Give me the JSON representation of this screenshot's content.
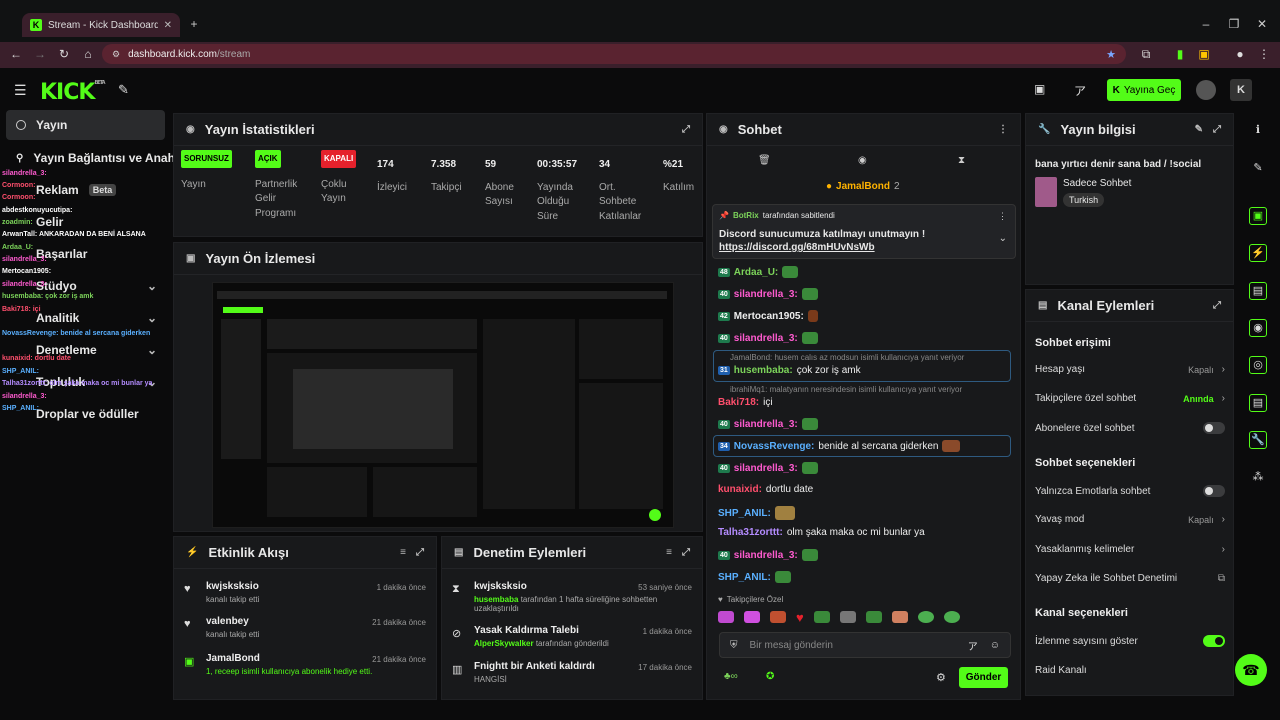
{
  "browser": {
    "tab_title": "Stream - Kick Dashboard",
    "url_domain": "dashboard.kick.com",
    "url_path": "/stream"
  },
  "app": {
    "logo": "KICK",
    "logo_beta": "BETA",
    "go_live": "Yayına Geç"
  },
  "sidebar": {
    "items": [
      {
        "label": "Yayın"
      },
      {
        "label": "Yayın Bağlantısı ve Anahtarı"
      },
      {
        "label": "Reklam",
        "badge": "Beta"
      },
      {
        "label": "Gelir"
      },
      {
        "label": "Başarılar"
      },
      {
        "label": "Stüdyo"
      },
      {
        "label": "Analitik"
      },
      {
        "label": "Denetleme"
      },
      {
        "label": "Topluluk"
      },
      {
        "label": "Droplar ve ödüller"
      }
    ],
    "overlay": [
      "silandrella_3:",
      "Cormoon:",
      "Cormoon:",
      "abdestkonuyucutipa:",
      "zoadmin:",
      "ArwanTall: ANKARADAN DA BENİ ALSANA",
      "Ardaa_U:",
      "silandrella_3:",
      "Mertocan1905:",
      "silandrella_3:",
      "husembaba: çok zor iş amk",
      "Baki718: içi",
      "NovassRevenge: benide al sercana giderken",
      "kunaixid: dortlu date",
      "SHP_ANIL:",
      "Talha31zorttt: olm şaka maka oc mi bunlar ya",
      "silandrella_3:",
      "SHP_ANIL:"
    ]
  },
  "stats": {
    "title": "Yayın İstatistikleri",
    "items": [
      {
        "badge": "SORUNSUZ",
        "label": "Yayın",
        "color": "#53fc18"
      },
      {
        "badge": "AÇIK",
        "label": "Partnerlik Gelir Programı",
        "color": "#53fc18"
      },
      {
        "badge": "KAPALI",
        "label": "Çoklu Yayın",
        "color": "#e5212c"
      },
      {
        "value": "174",
        "label": "İzleyici"
      },
      {
        "value": "7.358",
        "label": "Takipçi"
      },
      {
        "value": "59",
        "label": "Abone Sayısı"
      },
      {
        "value": "00:35:57",
        "label": "Yayında Olduğu Süre"
      },
      {
        "value": "34",
        "label": "Ort. Sohbete Katılanlar"
      },
      {
        "value": "%21",
        "label": "Katılım"
      }
    ]
  },
  "preview": {
    "title": "Yayın Ön İzlemesi"
  },
  "activity": {
    "title": "Etkinlik Akışı",
    "items": [
      {
        "name": "kwjsksksio",
        "sub": "kanalı takip etti",
        "time": "1 dakika önce"
      },
      {
        "name": "valenbey",
        "sub": "kanalı takip etti",
        "time": "21 dakika önce"
      },
      {
        "name": "JamalBond",
        "sub": "1, receep isimli kullanıcıya abonelik hediye etti.",
        "time": "21 dakika önce"
      }
    ]
  },
  "moderation": {
    "title": "Denetim Eylemleri",
    "items": [
      {
        "name": "kwjsksksio",
        "sub_user": "husembaba",
        "sub": "tarafından 1 hafta süreliğine sohbetten uzaklaştırıldı",
        "time": "53 saniye önce"
      },
      {
        "name": "Yasak Kaldırma Talebi",
        "sub_user": "AlperSkywalker",
        "sub": "tarafından gönderildi",
        "time": "1 dakika önce"
      },
      {
        "name": "Fnightt bir Anketi kaldırdı",
        "sub_user": "",
        "sub": "HANGİSİ",
        "time": "17 dakika önce"
      }
    ]
  },
  "chat": {
    "title": "Sohbet",
    "top_user": "JamalBond",
    "top_count": "2",
    "pinned_by": "BotRix",
    "pinned_label": "tarafından sabitlendi",
    "pinned_text": "Discord sunucumuza katılmayı unutmayın !",
    "pinned_link": "https://discord.gg/68mHUvNsWb",
    "messages": [
      {
        "lvl": "48",
        "user": "Ardaa_U:",
        "text": "",
        "color": "#7cd35a"
      },
      {
        "lvl": "40",
        "user": "silandrella_3:",
        "text": "",
        "color": "#ff5bd0"
      },
      {
        "lvl": "42",
        "user": "Mertocan1905:",
        "text": "",
        "color": "#eeeeee"
      },
      {
        "lvl": "40",
        "user": "silandrella_3:",
        "text": "",
        "color": "#ff5bd0"
      },
      {
        "reply": "JamalBond: husem calıs az modsun isimli kullanıcıya yanıt veriyor"
      },
      {
        "lvl": "31",
        "user": "husembaba:",
        "text": "çok zor iş amk",
        "color": "#7cd35a"
      },
      {
        "reply": "ibrahiMq1: malatyanın neresindesin isimli kullanıcıya yanıt veriyor"
      },
      {
        "lvl": "",
        "user": "Baki718:",
        "text": "içi",
        "color": "#ff4f6d"
      },
      {
        "lvl": "40",
        "user": "silandrella_3:",
        "text": "",
        "color": "#ff5bd0"
      },
      {
        "lvl": "34",
        "user": "NovassRevenge:",
        "text": "benide al sercana giderken",
        "color": "#5ab0ff"
      },
      {
        "lvl": "40",
        "user": "silandrella_3:",
        "text": "",
        "color": "#ff5bd0"
      },
      {
        "lvl": "",
        "user": "kunaixid:",
        "text": "dortlu date",
        "color": "#ff4f6d"
      },
      {
        "lvl": "",
        "user": "SHP_ANIL:",
        "text": "",
        "color": "#5ab0ff"
      },
      {
        "lvl": "",
        "user": "Talha31zorttt:",
        "text": "olm şaka maka oc mi bunlar ya",
        "color": "#b48cff"
      },
      {
        "lvl": "40",
        "user": "silandrella_3:",
        "text": "",
        "color": "#ff5bd0"
      },
      {
        "lvl": "",
        "user": "SHP_ANIL:",
        "text": "",
        "color": "#5ab0ff"
      }
    ],
    "followers_only": "Takipçilere Özel",
    "input_placeholder": "Bir mesaj gönderin",
    "send": "Gönder"
  },
  "stream_info": {
    "title": "Yayın bilgisi",
    "stream_title": "bana yırtıcı denir sana bad / !social",
    "category": "Sadece Sohbet",
    "language": "Turkish"
  },
  "channel_actions": {
    "title": "Kanal Eylemleri",
    "chat_access": "Sohbet erişimi",
    "account_age": {
      "label": "Hesap yaşı",
      "value": "Kapalı"
    },
    "followers_chat": {
      "label": "Takipçilere özel sohbet",
      "value": "Anında"
    },
    "subs_chat": {
      "label": "Abonelere özel sohbet"
    },
    "chat_options": "Sohbet seçenekleri",
    "emotes_only": {
      "label": "Yalnızca Emotlarla sohbet"
    },
    "slow_mode": {
      "label": "Yavaş mod",
      "value": "Kapalı"
    },
    "banned_words": {
      "label": "Yasaklanmış kelimeler"
    },
    "ai_mod": {
      "label": "Yapay Zeka ile Sohbet Denetimi"
    },
    "channel_options": "Kanal seçenekleri",
    "show_views": {
      "label": "İzlenme sayısını göster"
    },
    "raid": {
      "label": "Raid Kanalı"
    }
  },
  "colors": {
    "accent": "#53fc18",
    "bg": "#0b0b0c",
    "panel": "#18191b"
  }
}
